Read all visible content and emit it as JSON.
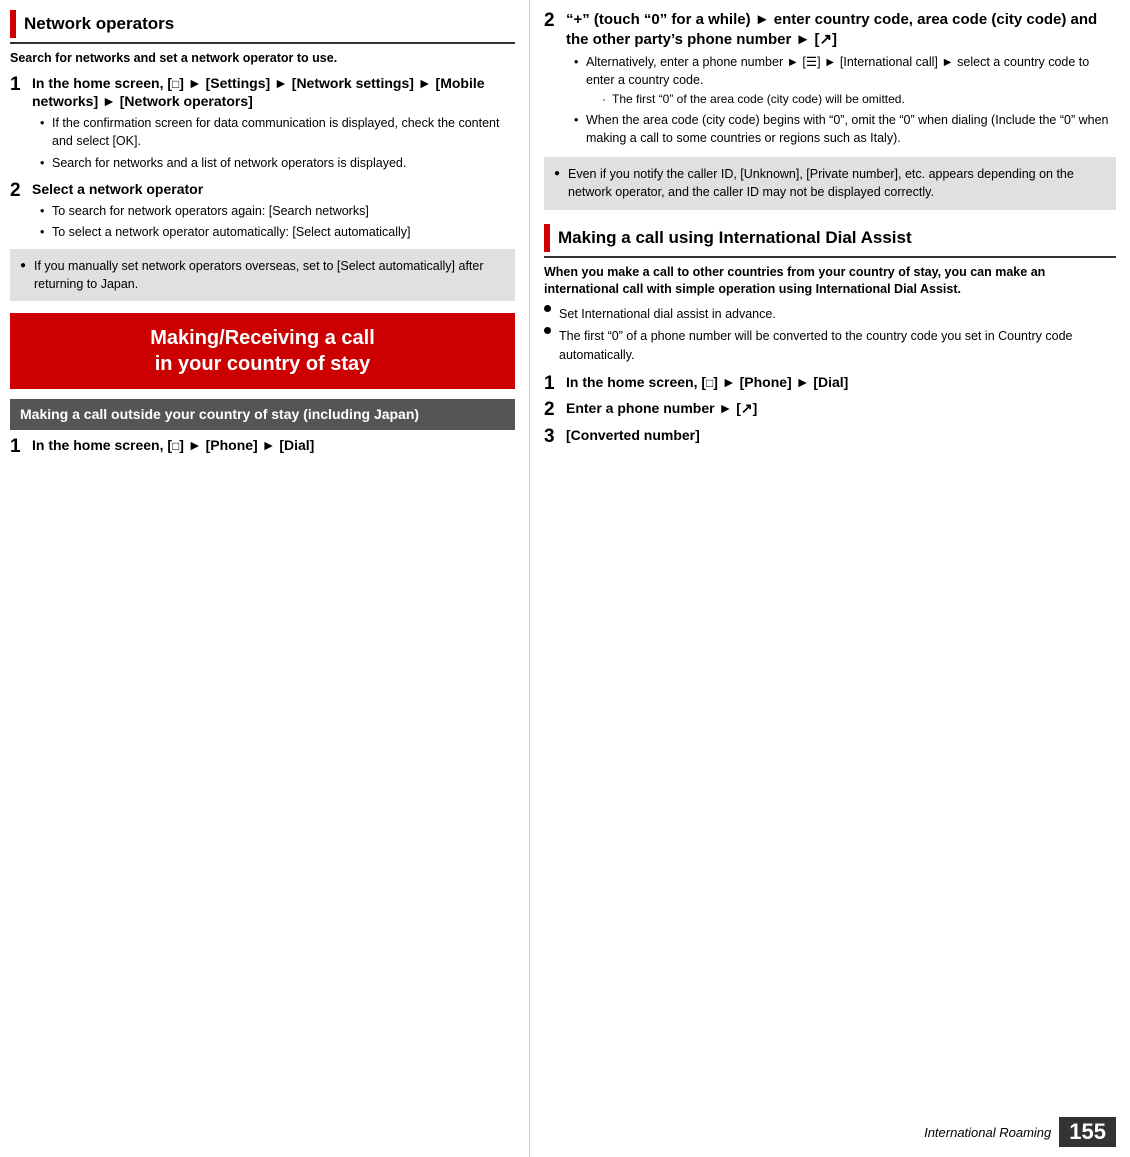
{
  "left": {
    "section1": {
      "title": "Network operators",
      "subtitle": "Search for networks and set a network operator to use.",
      "step1": {
        "number": "1",
        "title": "In the home screen, [■] ▶ [Settings] ▶ [Network settings] ▶ [Mobile networks] ▶ [Network operators]",
        "bullets": [
          "If the confirmation screen for data communication is displayed, check the content and select [OK].",
          "Search for networks and a list of network operators is displayed."
        ]
      },
      "step2": {
        "number": "2",
        "title": "Select a network operator",
        "bullets": [
          "To search for network operators again: [Search networks]",
          "To select a network operator automatically: [Select automatically]"
        ]
      },
      "note": "If you manually set network operators overseas, set to [Select automatically] after returning to Japan."
    },
    "banner": {
      "line1": "Making/Receiving a call",
      "line2": "in your country of stay"
    },
    "subsection": {
      "title": "Making a call outside your country of stay (including Japan)",
      "step1": {
        "number": "1",
        "title": "In the home screen, [■] ▶ [Phone] ▶ [Dial]"
      }
    }
  },
  "right": {
    "step2": {
      "number": "2",
      "title": "“+” (touch “0” for a while) ▶ enter country code, area code (city code) and the other party’s phone number ▶ [↗]",
      "bullets": [
        {
          "text": "Alternatively, enter a phone number ▶ [≡] ▶ [International call] ▶ select a country code to enter a country code.",
          "subbullets": [
            "The first “0” of the area code (city code) will be omitted."
          ]
        },
        {
          "text": "When the area code (city code) begins with “0”, omit the “0” when dialing (Include the “0” when making a call to some countries or regions such as Italy).",
          "subbullets": []
        }
      ]
    },
    "note": "Even if you notify the caller ID, [Unknown], [Private number], etc. appears depending on the network operator, and the caller ID may not be displayed correctly.",
    "section2": {
      "title": "Making a call using International Dial Assist",
      "subtitle": "When you make a call to other countries from your country of stay, you can make an international call with simple operation using International Dial Assist.",
      "notes": [
        "Set International dial assist in advance.",
        "The first “0” of a phone number will be converted to the country code you set in Country code automatically."
      ],
      "step1": {
        "number": "1",
        "title": "In the home screen, [■] ▶ [Phone] ▶ [Dial]"
      },
      "step2": {
        "number": "2",
        "title": "Enter a phone number ▶ [↗]"
      },
      "step3": {
        "number": "3",
        "title": "[Converted number]"
      }
    },
    "footer": {
      "label": "International Roaming",
      "number": "155"
    }
  }
}
